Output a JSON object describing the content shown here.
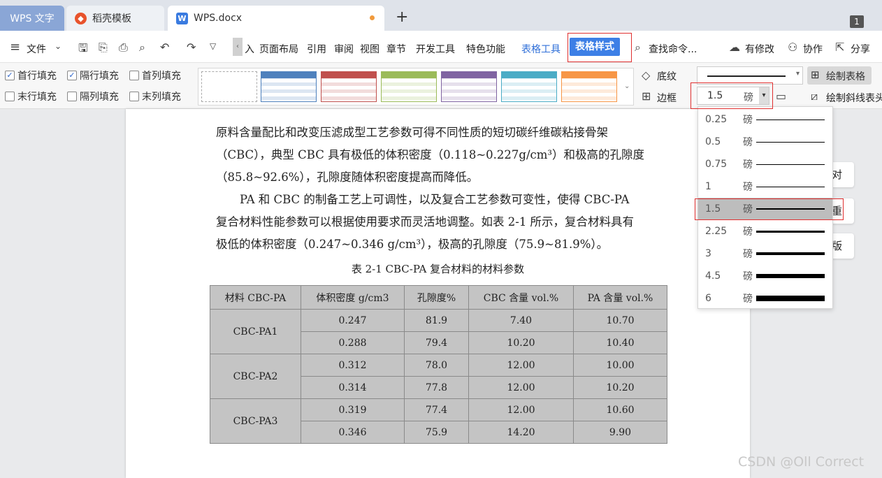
{
  "tabs": {
    "app": "WPS 文字",
    "docer": "稻壳模板",
    "document": "WPS.docx",
    "new_tab": "+",
    "window_count": "1"
  },
  "menu": {
    "file": "文件",
    "items": [
      "入",
      "页面布局",
      "引用",
      "审阅",
      "视图",
      "章节",
      "开发工具",
      "特色功能"
    ],
    "table_tools": "表格工具",
    "table_style": "表格样式",
    "search": "查找命令...",
    "changes": "有修改",
    "collab": "协作",
    "share": "分享"
  },
  "toolbar": {
    "checks": [
      {
        "label": "首行填充",
        "checked": true
      },
      {
        "label": "隔行填充",
        "checked": true
      },
      {
        "label": "首列填充",
        "checked": false
      },
      {
        "label": "末行填充",
        "checked": false
      },
      {
        "label": "隔列填充",
        "checked": false
      },
      {
        "label": "末列填充",
        "checked": false
      }
    ],
    "shading": "底纹",
    "border": "边框",
    "line_width_value": "1.5",
    "line_width_unit": "磅",
    "draw_table": "绘制表格",
    "draw_diagonal": "绘制斜线表头",
    "swatch_colors": [
      "#ffffff",
      "#4f81bd",
      "#c0504d",
      "#9bbb59",
      "#8064a2",
      "#4bacc6",
      "#f79646"
    ]
  },
  "document": {
    "para1": [
      "原料含量配比和改变压滤成型工艺参数可得不同性质的短切碳纤维碳粘接骨架",
      "（CBC），典型 CBC 具有极低的体积密度（0.118~0.227g/cm³）和极高的孔隙度",
      "（85.8~92.6%），孔隙度随体积密度提高而降低。"
    ],
    "para2": [
      "PA 和 CBC 的制备工艺上可调性，以及复合工艺参数可变性，使得 CBC-PA",
      "复合材料性能参数可以根据使用要求而灵活地调整。如表 2-1 所示，复合材料具有",
      "极低的体积密度（0.247~0.346 g/cm³），极高的孔隙度（75.9~81.9%）。"
    ],
    "caption": "表 2-1 CBC-PA 复合材料的材料参数",
    "table": {
      "headers": [
        "材料 CBC-PA",
        "体积密度 g/cm3",
        "孔隙度%",
        "CBC 含量 vol.%",
        "PA 含量 vol.%"
      ],
      "groups": [
        {
          "name": "CBC-PA1",
          "rows": [
            [
              "0.247",
              "81.9",
              "7.40",
              "10.70"
            ],
            [
              "0.288",
              "79.4",
              "10.20",
              "10.40"
            ]
          ]
        },
        {
          "name": "CBC-PA2",
          "rows": [
            [
              "0.312",
              "78.0",
              "12.00",
              "10.00"
            ],
            [
              "0.314",
              "77.8",
              "12.00",
              "10.20"
            ]
          ]
        },
        {
          "name": "CBC-PA3",
          "rows": [
            [
              "0.319",
              "77.4",
              "12.00",
              "10.60"
            ],
            [
              "0.346",
              "75.9",
              "14.20",
              "9.90"
            ]
          ]
        }
      ]
    }
  },
  "dropdown": {
    "unit": "磅",
    "options": [
      {
        "value": "0.25",
        "weight": 1,
        "selected": false
      },
      {
        "value": "0.5",
        "weight": 1,
        "selected": false
      },
      {
        "value": "0.75",
        "weight": 1,
        "selected": false
      },
      {
        "value": "1",
        "weight": 1,
        "selected": false
      },
      {
        "value": "1.5",
        "weight": 2,
        "selected": true
      },
      {
        "value": "2.25",
        "weight": 3,
        "selected": false
      },
      {
        "value": "3",
        "weight": 4,
        "selected": false
      },
      {
        "value": "4.5",
        "weight": 6,
        "selected": false
      },
      {
        "value": "6",
        "weight": 8,
        "selected": false
      }
    ]
  },
  "side_panel": {
    "btn1": "对",
    "btn2": "重",
    "btn3": "版"
  },
  "watermark": "CSDN @Oll Correct"
}
